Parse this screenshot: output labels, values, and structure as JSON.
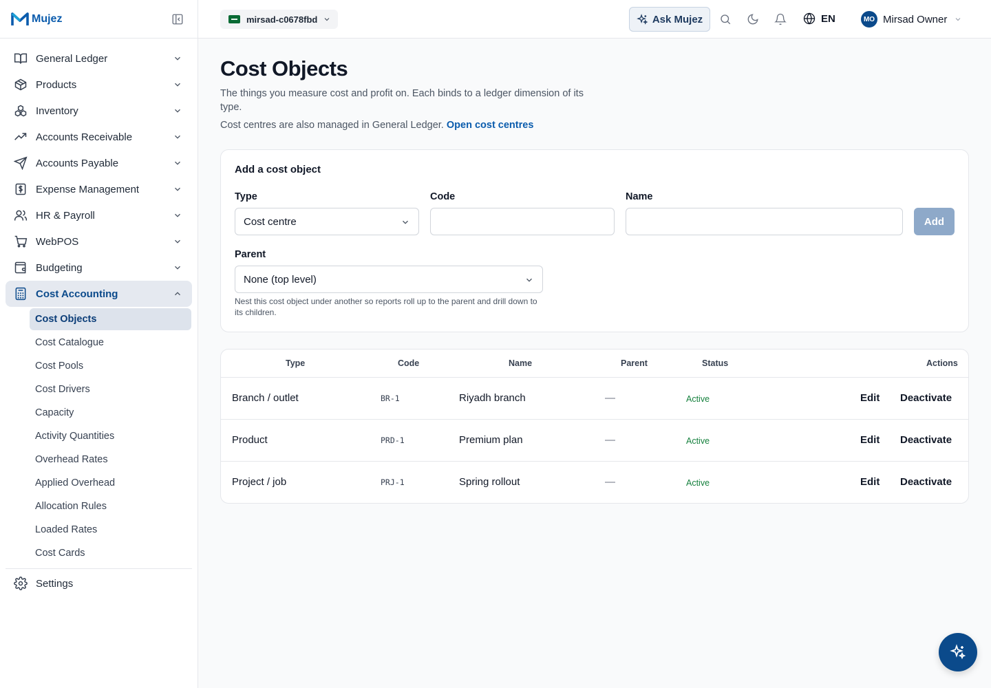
{
  "brand": {
    "name": "Mujez"
  },
  "sidebar": {
    "items": [
      {
        "label": "General Ledger",
        "icon": "book-icon"
      },
      {
        "label": "Products",
        "icon": "box-icon"
      },
      {
        "label": "Inventory",
        "icon": "boxes-icon"
      },
      {
        "label": "Accounts Receivable",
        "icon": "trending-up-icon"
      },
      {
        "label": "Accounts Payable",
        "icon": "send-icon"
      },
      {
        "label": "Expense Management",
        "icon": "receipt-icon"
      },
      {
        "label": "HR & Payroll",
        "icon": "users-icon"
      },
      {
        "label": "WebPOS",
        "icon": "cart-icon"
      },
      {
        "label": "Budgeting",
        "icon": "wallet-icon"
      },
      {
        "label": "Cost Accounting",
        "icon": "calculator-icon"
      }
    ],
    "cost_accounting_sub": [
      "Cost Objects",
      "Cost Catalogue",
      "Cost Pools",
      "Cost Drivers",
      "Capacity",
      "Activity Quantities",
      "Overhead Rates",
      "Applied Overhead",
      "Allocation Rules",
      "Loaded Rates",
      "Cost Cards"
    ],
    "settings_label": "Settings"
  },
  "topbar": {
    "org_name": "mirsad-c0678fbd",
    "ask_label": "Ask Mujez",
    "lang": "EN",
    "user_initials": "MO",
    "user_name": "Mirsad Owner"
  },
  "page": {
    "title": "Cost Objects",
    "description": "The things you measure cost and profit on. Each binds to a ledger dimension of its type.",
    "note_text": "Cost centres are also managed in General Ledger.",
    "note_link": "Open cost centres"
  },
  "form": {
    "title": "Add a cost object",
    "type_label": "Type",
    "type_value": "Cost centre",
    "code_label": "Code",
    "code_value": "",
    "name_label": "Name",
    "name_value": "",
    "add_label": "Add",
    "parent_label": "Parent",
    "parent_value": "None (top level)",
    "parent_help": "Nest this cost object under another so reports roll up to the parent and drill down to its children."
  },
  "table": {
    "headers": {
      "type": "Type",
      "code": "Code",
      "name": "Name",
      "parent": "Parent",
      "status": "Status",
      "actions": "Actions"
    },
    "rows": [
      {
        "type": "Branch / outlet",
        "code": "BR-1",
        "name": "Riyadh branch",
        "parent": "—",
        "status": "Active",
        "edit": "Edit",
        "deactivate": "Deactivate"
      },
      {
        "type": "Product",
        "code": "PRD-1",
        "name": "Premium plan",
        "parent": "—",
        "status": "Active",
        "edit": "Edit",
        "deactivate": "Deactivate"
      },
      {
        "type": "Project / job",
        "code": "PRJ-1",
        "name": "Spring rollout",
        "parent": "—",
        "status": "Active",
        "edit": "Edit",
        "deactivate": "Deactivate"
      }
    ]
  },
  "colors": {
    "accent": "#0b4a8b",
    "link": "#0b5cad",
    "status_active": "#15803d"
  }
}
